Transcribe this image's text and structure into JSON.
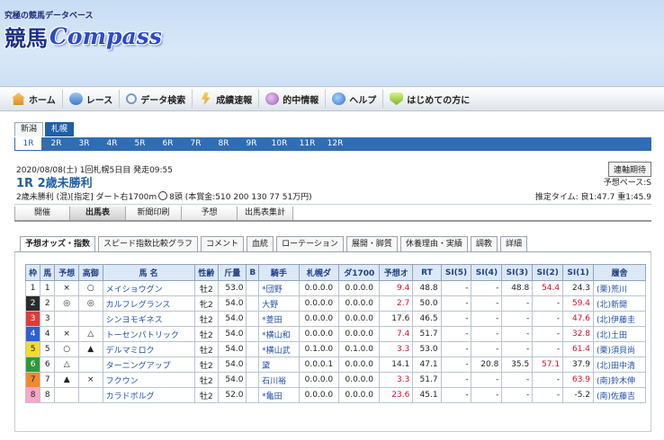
{
  "header": {
    "tagline": "究極の競馬データベース",
    "logo_kanji": "競馬",
    "logo_latin": "Compass"
  },
  "nav": [
    {
      "label": "ホーム",
      "icon": "home-icon"
    },
    {
      "label": "レース",
      "icon": "race-icon"
    },
    {
      "label": "データ検索",
      "icon": "search-icon"
    },
    {
      "label": "成績速報",
      "icon": "result-icon"
    },
    {
      "label": "的中情報",
      "icon": "hit-icon"
    },
    {
      "label": "ヘルプ",
      "icon": "help-icon"
    },
    {
      "label": "はじめての方に",
      "icon": "beginner-icon"
    }
  ],
  "venues": [
    "新潟",
    "札幌"
  ],
  "active_venue": "札幌",
  "races": [
    "1R",
    "2R",
    "3R",
    "4R",
    "5R",
    "6R",
    "7R",
    "8R",
    "9R",
    "10R",
    "11R",
    "12R"
  ],
  "active_race": "1R",
  "race": {
    "date_line": "2020/08/08(土)  1回札幌5日目  発走09:55",
    "title": "1R  2歳未勝利",
    "conditions_a": "2歳未勝利 (混)[指定]  ダート右1700m",
    "conditions_b": "8頭 (本賞金:510 200 130 77 51万円)",
    "button": "連軸期待",
    "pace": "予想ペース:S",
    "time": "推定タイム: 良1:47.7 重1:45.9"
  },
  "sub_tabs": [
    "開催",
    "出馬表",
    "新聞印刷",
    "予想",
    "出馬表集計"
  ],
  "active_sub_tab": "出馬表",
  "content_tabs": [
    "予想オッズ・指数",
    "スピード指数比較グラフ",
    "コメント",
    "血統",
    "ローテーション",
    "展開・脚質",
    "休養理由・実績",
    "調教",
    "詳細"
  ],
  "active_content_tab": "予想オッズ・指数",
  "table": {
    "headers": [
      "枠",
      "馬",
      "予想",
      "高御",
      "馬 名",
      "性齢",
      "斤量",
      "B",
      "騎手",
      "札幌ダ",
      "ダ1700",
      "予想オ",
      "RT",
      "SI(5)",
      "SI(4)",
      "SI(3)",
      "SI(2)",
      "SI(1)",
      "履舎"
    ],
    "rows": [
      {
        "waku": "1",
        "uma": "1",
        "yoso": "×",
        "kogyo": "○",
        "name": "メイショウグン",
        "sex": "牡2",
        "kin": "53.0",
        "b": "",
        "jockey": "*団野",
        "sap": "0.0.0.0",
        "d1700": "0.0.0.0",
        "odds": "9.4",
        "rt": "48.8",
        "si5": "-",
        "si4": "-",
        "si3": "48.8",
        "si2": "54.4",
        "si1": "24.3",
        "stable": "(栗)荒川",
        "odds_red": true,
        "si2_red": true
      },
      {
        "waku": "2",
        "uma": "2",
        "yoso": "◎",
        "kogyo": "◎",
        "name": "カルフレグランス",
        "sex": "牝2",
        "kin": "54.0",
        "b": "",
        "jockey": "大野",
        "sap": "0.0.0.0",
        "d1700": "0.0.0.0",
        "odds": "2.7",
        "rt": "50.0",
        "si5": "-",
        "si4": "-",
        "si3": "-",
        "si2": "-",
        "si1": "59.4",
        "stable": "(北)新開",
        "odds_red": true,
        "si1_red": true
      },
      {
        "waku": "3",
        "uma": "3",
        "yoso": "",
        "kogyo": "",
        "name": "シンヨモギネス",
        "sex": "牡2",
        "kin": "54.0",
        "b": "",
        "jockey": "*菱田",
        "sap": "0.0.0.0",
        "d1700": "0.0.0.0",
        "odds": "17.6",
        "rt": "46.5",
        "si5": "-",
        "si4": "-",
        "si3": "-",
        "si2": "-",
        "si1": "47.6",
        "stable": "(北)伊藤圭",
        "si1_red": true
      },
      {
        "waku": "4",
        "uma": "4",
        "yoso": "×",
        "kogyo": "△",
        "name": "トーセンパトリック",
        "sex": "牡2",
        "kin": "54.0",
        "b": "",
        "jockey": "*横山和",
        "sap": "0.0.0.0",
        "d1700": "0.0.0.0",
        "odds": "7.4",
        "rt": "51.7",
        "si5": "-",
        "si4": "-",
        "si3": "-",
        "si2": "-",
        "si1": "32.8",
        "stable": "(北)土田",
        "odds_red": true,
        "si1_red": true
      },
      {
        "waku": "5",
        "uma": "5",
        "yoso": "○",
        "kogyo": "▲",
        "name": "デルマミロク",
        "sex": "牡2",
        "kin": "54.0",
        "b": "",
        "jockey": "*横山武",
        "sap": "0.1.0.0",
        "d1700": "0.1.0.0",
        "odds": "3.3",
        "rt": "53.0",
        "si5": "-",
        "si4": "-",
        "si3": "-",
        "si2": "-",
        "si1": "61.4",
        "stable": "(栗)須貝尚",
        "odds_red": true,
        "si1_red": true
      },
      {
        "waku": "6",
        "uma": "6",
        "yoso": "△",
        "kogyo": "",
        "name": "ターニングアップ",
        "sex": "牡2",
        "kin": "54.0",
        "b": "",
        "jockey": " 黛",
        "sap": "0.0.0.1",
        "d1700": "0.0.0.0",
        "odds": "14.1",
        "rt": "47.1",
        "si5": "-",
        "si4": "20.8",
        "si3": "35.5",
        "si2": "57.1",
        "si1": "37.9",
        "stable": "(北)田中清",
        "si2_red": true
      },
      {
        "waku": "7",
        "uma": "7",
        "yoso": "▲",
        "kogyo": "×",
        "name": "フクウン",
        "sex": "牡2",
        "kin": "54.0",
        "b": "",
        "jockey": "石川裕",
        "sap": "0.0.0.0",
        "d1700": "0.0.0.0",
        "odds": "3.3",
        "rt": "51.7",
        "si5": "-",
        "si4": "-",
        "si3": "-",
        "si2": "-",
        "si1": "63.9",
        "stable": "(南)鈴木伸",
        "odds_red": true,
        "si1_red": true
      },
      {
        "waku": "8",
        "uma": "8",
        "yoso": "",
        "kogyo": "",
        "name": "カラドボルグ",
        "sex": "牡2",
        "kin": "52.0",
        "b": "",
        "jockey": "*亀田",
        "sap": "0.0.0.0",
        "d1700": "0.0.0.0",
        "odds": "23.6",
        "rt": "45.1",
        "si5": "-",
        "si4": "-",
        "si3": "-",
        "si2": "-",
        "si1": "-5.2",
        "stable": "(南)佐藤吉",
        "odds_red": true
      }
    ]
  }
}
